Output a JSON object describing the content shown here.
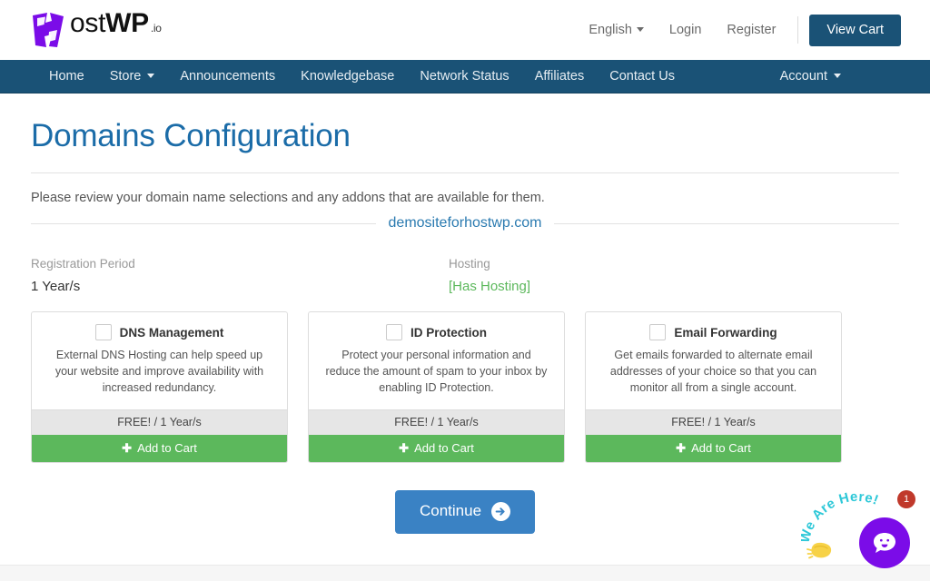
{
  "brand": {
    "logo_text_light": "ost",
    "logo_text_bold": "WP",
    "logo_suffix": ".io",
    "logo_mark_color": "#7b0ce8",
    "primary_dark": "#1a5276",
    "accent_blue": "#1b6ca8",
    "success_green": "#5cb85c"
  },
  "topbar": {
    "language": "English",
    "login": "Login",
    "register": "Register",
    "view_cart": "View Cart"
  },
  "mainnav": {
    "items": [
      {
        "label": "Home",
        "has_caret": false
      },
      {
        "label": "Store",
        "has_caret": true
      },
      {
        "label": "Announcements",
        "has_caret": false
      },
      {
        "label": "Knowledgebase",
        "has_caret": false
      },
      {
        "label": "Network Status",
        "has_caret": false
      },
      {
        "label": "Affiliates",
        "has_caret": false
      },
      {
        "label": "Contact Us",
        "has_caret": false
      }
    ],
    "account": "Account"
  },
  "page": {
    "title": "Domains Configuration",
    "description": "Please review your domain name selections and any addons that are available for them.",
    "domain": "demositeforhostwp.com"
  },
  "domain_info": [
    {
      "label": "Registration Period",
      "value": "1 Year/s",
      "status": false
    },
    {
      "label": "Hosting",
      "value": "[Has Hosting]",
      "status": true
    }
  ],
  "addons": [
    {
      "title": "DNS Management",
      "description": "External DNS Hosting can help speed up your website and improve availability with increased redundancy.",
      "price": "FREE! / 1 Year/s",
      "button": "Add to Cart",
      "checked": false
    },
    {
      "title": "ID Protection",
      "description": "Protect your personal information and reduce the amount of spam to your inbox by enabling ID Protection.",
      "price": "FREE! / 1 Year/s",
      "button": "Add to Cart",
      "checked": false
    },
    {
      "title": "Email Forwarding",
      "description": "Get emails forwarded to alternate email addresses of your choice so that you can monitor all from a single account.",
      "price": "FREE! / 1 Year/s",
      "button": "Add to Cart",
      "checked": false
    }
  ],
  "actions": {
    "continue": "Continue"
  },
  "chat": {
    "prompt": "We Are Here!",
    "badge_count": "1",
    "bubble_color": "#7b0ce8",
    "badge_color": "#c0392b",
    "prompt_color": "#2ec8d8"
  }
}
